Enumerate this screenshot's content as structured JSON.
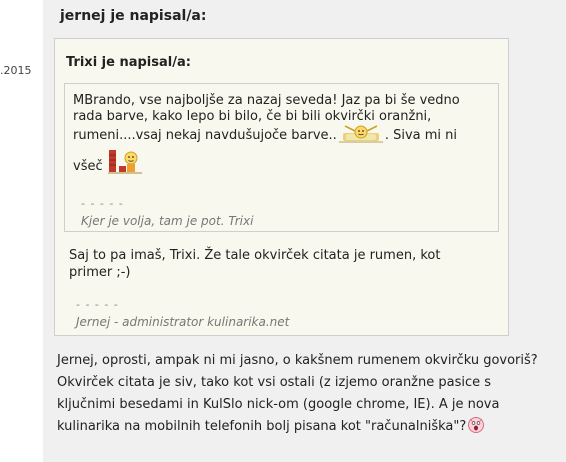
{
  "post": {
    "date_fragment": ".2015",
    "quote_head": "jernej je napisal/a:",
    "nested_quote": {
      "head": "Trixi je napisal/a:",
      "line1": "MBrando, vse najboljše za nazaj seveda! Jaz pa bi še vedno",
      "line2": "rada barve, kako lepo bi bilo,  če bi bili okvirčki oranžni,",
      "line3": "rumeni....vsaj nekaj navdušujoče barve..",
      "line3_after": ". Siva mi ni",
      "line4": "všeč",
      "sig_dashes": "- - - - -",
      "signature": "Kjer je volja, tam je pot. Trixi"
    },
    "quote_reply_line1": "Saj to pa imaš, Trixi. Že tale okvirček citata je rumen, kot",
    "quote_reply_line2": "primer ;-)",
    "quote_sig_dashes": "- - - - -",
    "quote_signature": "Jernej - administrator kulinarika.net",
    "reply_line1": "Jernej, oprosti, ampak ni mi jasno, o kakšnem rumenem okvirčku govoriš?",
    "reply_line2": "Okvirček citata je siv, tako kot vsi ostali (z izjemo oranžne pasice  s",
    "reply_line3": "ključnimi besedami in KulSlo nick-om (google chrome, IE). A je nova",
    "reply_line4": "kulinarika na mobilnih telefonih bolj pisana kot \"računalniška\"?",
    "smileys": [
      "stretching-smiley-icon",
      "bricks-smiley-icon",
      "shocked-smiley-icon"
    ],
    "colors": {
      "post_background": "#f0f0f0",
      "quote_background": "#f8f8ee",
      "quote_border": "#cfcfcf",
      "signature": "#777777"
    }
  }
}
